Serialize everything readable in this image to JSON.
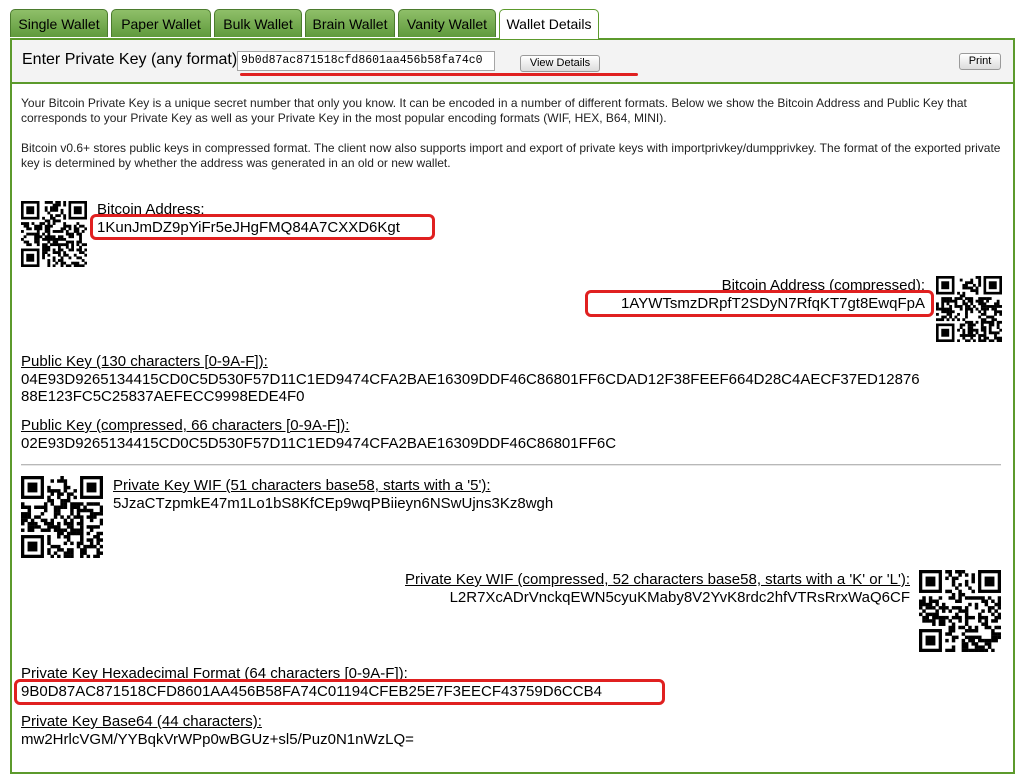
{
  "tabs": [
    {
      "label": "Single Wallet"
    },
    {
      "label": "Paper Wallet"
    },
    {
      "label": "Bulk Wallet"
    },
    {
      "label": "Brain Wallet"
    },
    {
      "label": "Vanity Wallet"
    },
    {
      "label": "Wallet Details",
      "active": true
    }
  ],
  "topbar": {
    "label": "Enter Private Key (any format)",
    "input_value": "9b0d87ac871518cfd8601aa456b58fa74c0",
    "view_button": "View Details",
    "print_button": "Print"
  },
  "intro": {
    "p1": "Your Bitcoin Private Key is a unique secret number that only you know. It can be encoded in a number of different formats. Below we show the Bitcoin Address and Public Key that corresponds to your Private Key as well as your Private Key in the most popular encoding formats (WIF, HEX, B64, MINI).",
    "p2": "Bitcoin v0.6+ stores public keys in compressed format. The client now also supports import and export of private keys with importprivkey/dumpprivkey. The format of the exported private key is determined by whether the address was generated in an old or new wallet."
  },
  "details": {
    "address_label": "Bitcoin Address:",
    "address": "1KunJmDZ9pYiFr5eJHgFMQ84A7CXXD6Kgt",
    "address_comp_label": "Bitcoin Address (compressed):",
    "address_comp": "1AYWTsmzDRpfT2SDyN7RfqKT7gt8EwqFpA",
    "pub_label": "Public Key (130 characters [0-9A-F]):",
    "pub_line1": "04E93D9265134415CD0C5D530F57D11C1ED9474CFA2BAE16309DDF46C86801FF6CDAD12F38FEEF664D28C4AECF37ED12876",
    "pub_line2": "88E123FC5C25837AEFECC9998EDE4F0",
    "pub_comp_label": "Public Key (compressed, 66 characters [0-9A-F]):",
    "pub_comp": "02E93D9265134415CD0C5D530F57D11C1ED9474CFA2BAE16309DDF46C86801FF6C",
    "wif_label": "Private Key WIF (51 characters base58, starts with a '5'):",
    "wif": "5JzaCTzpmkE47m1Lo1bS8KfCEp9wqPBiieyn6NSwUjns3Kz8wgh",
    "wif_comp_label": "Private Key WIF (compressed, 52 characters base58, starts with a 'K' or 'L'):",
    "wif_comp": "L2R7XcADrVnckqEWN5cyuKMaby8V2YvK8rdc2hfVTRsRrxWaQ6CF",
    "hex_label": "Private Key Hexadecimal Format (64 characters [0-9A-F]):",
    "hex": "9B0D87AC871518CFD8601AA456B58FA74C01194CFEB25E7F3EECF43759D6CCB4",
    "b64_label": "Private Key Base64 (44 characters):",
    "b64": "mw2HrlcVGM/YYBqkVrWPp0wBGUz+sl5/Puz0N1nWzLQ="
  },
  "qr_codes": [
    {
      "name": "qr-bitcoin-address-icon",
      "seed": 11
    },
    {
      "name": "qr-bitcoin-address-compressed-icon",
      "seed": 23
    },
    {
      "name": "qr-private-key-wif-icon",
      "seed": 37
    },
    {
      "name": "qr-private-key-wif-compressed-icon",
      "seed": 51
    }
  ],
  "colors": {
    "accent_green": "#5c9a2c",
    "highlight_red": "#e02020"
  }
}
